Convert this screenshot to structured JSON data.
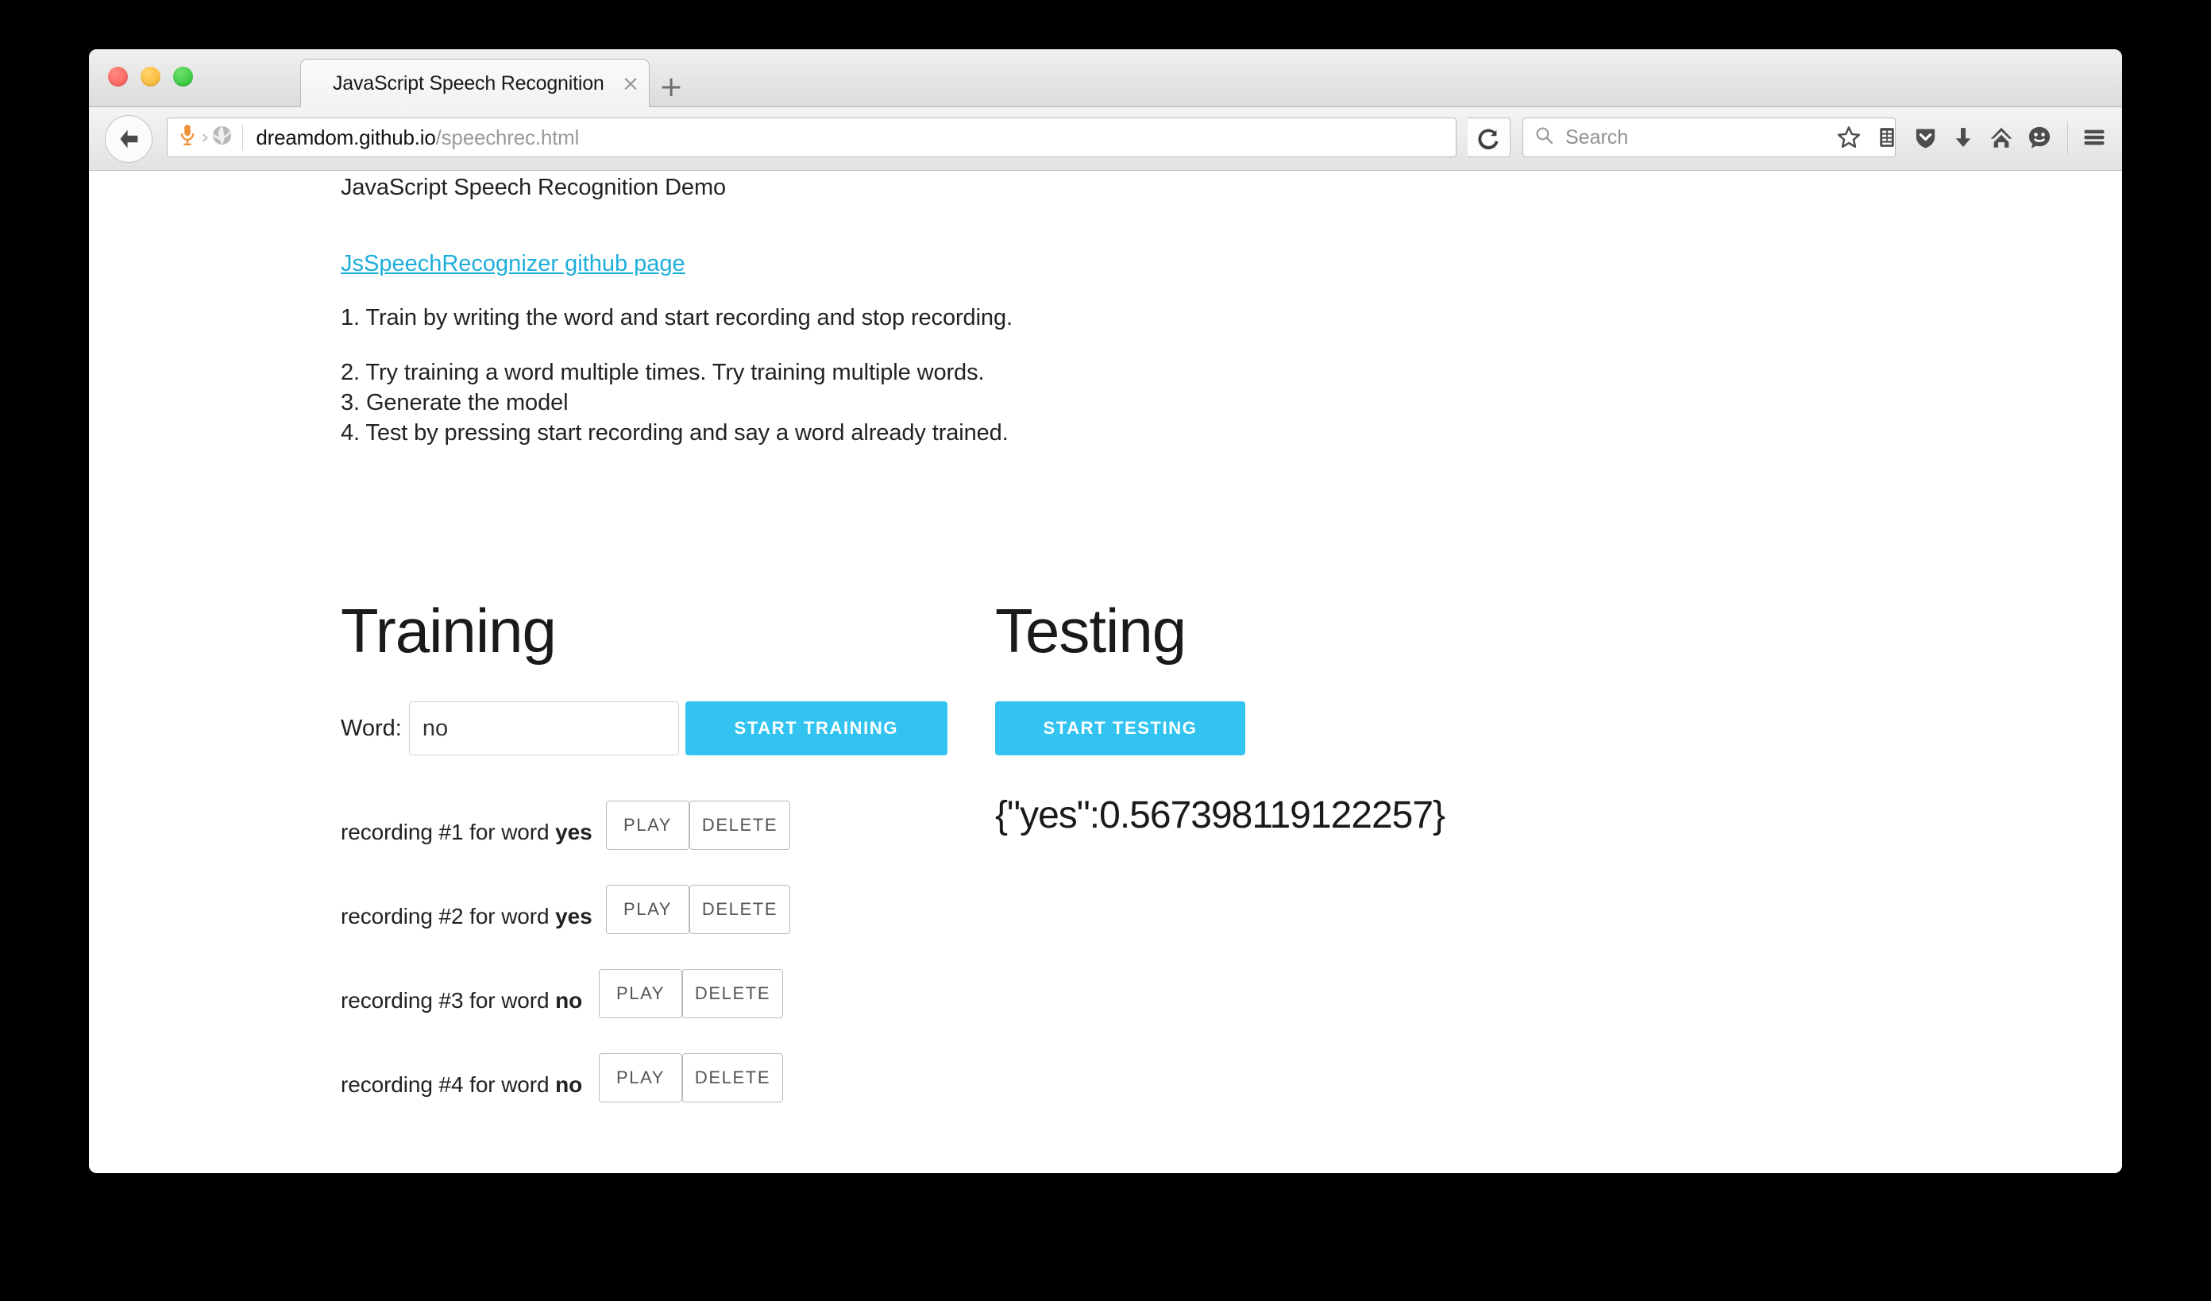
{
  "browser": {
    "tab": {
      "title": "JavaScript Speech Recognition",
      "close_label": "×"
    },
    "new_tab_label": "+",
    "url": {
      "host": "dreamdom.github.io",
      "path": "/speechrec.html"
    },
    "search": {
      "placeholder": "Search",
      "value": ""
    },
    "icons": {
      "back": "back-arrow-icon",
      "mic_permission": "microphone-icon",
      "identity_chevron": "chevron-right-icon",
      "site_identity": "globe-icon",
      "reload": "reload-icon",
      "search": "search-icon",
      "bookmark": "star-icon",
      "library": "library-icon",
      "pocket": "pocket-shield-icon",
      "downloads": "download-arrow-icon",
      "home": "home-icon",
      "sync": "smiley-face-icon",
      "menu": "hamburger-menu-icon"
    }
  },
  "page": {
    "title": "JavaScript Speech Recognition Demo",
    "github_link": "JsSpeechRecognizer github page",
    "steps": [
      "1. Train by writing the word and start recording and stop recording.",
      "2. Try training a word multiple times. Try training multiple words.",
      "3. Generate the model",
      "4. Test by pressing start recording and say a word already trained."
    ],
    "training": {
      "heading": "Training",
      "word_label": "Word:",
      "word_value": "no",
      "word_placeholder": "",
      "start_button": "START TRAINING",
      "recordings": [
        {
          "prefix": "recording #1 for word ",
          "word": "yes",
          "play": "PLAY",
          "delete": "DELETE"
        },
        {
          "prefix": "recording #2 for word ",
          "word": "yes",
          "play": "PLAY",
          "delete": "DELETE"
        },
        {
          "prefix": "recording #3 for word ",
          "word": "no",
          "play": "PLAY",
          "delete": "DELETE"
        },
        {
          "prefix": "recording #4 for word ",
          "word": "no",
          "play": "PLAY",
          "delete": "DELETE"
        }
      ]
    },
    "testing": {
      "heading": "Testing",
      "start_button": "START TESTING",
      "result": "{\"yes\":0.567398119122257}"
    }
  },
  "colors": {
    "accent_blue": "#33c3f0",
    "link_blue": "#1eaedb",
    "mic_orange": "#f19137",
    "text": "#222222"
  }
}
